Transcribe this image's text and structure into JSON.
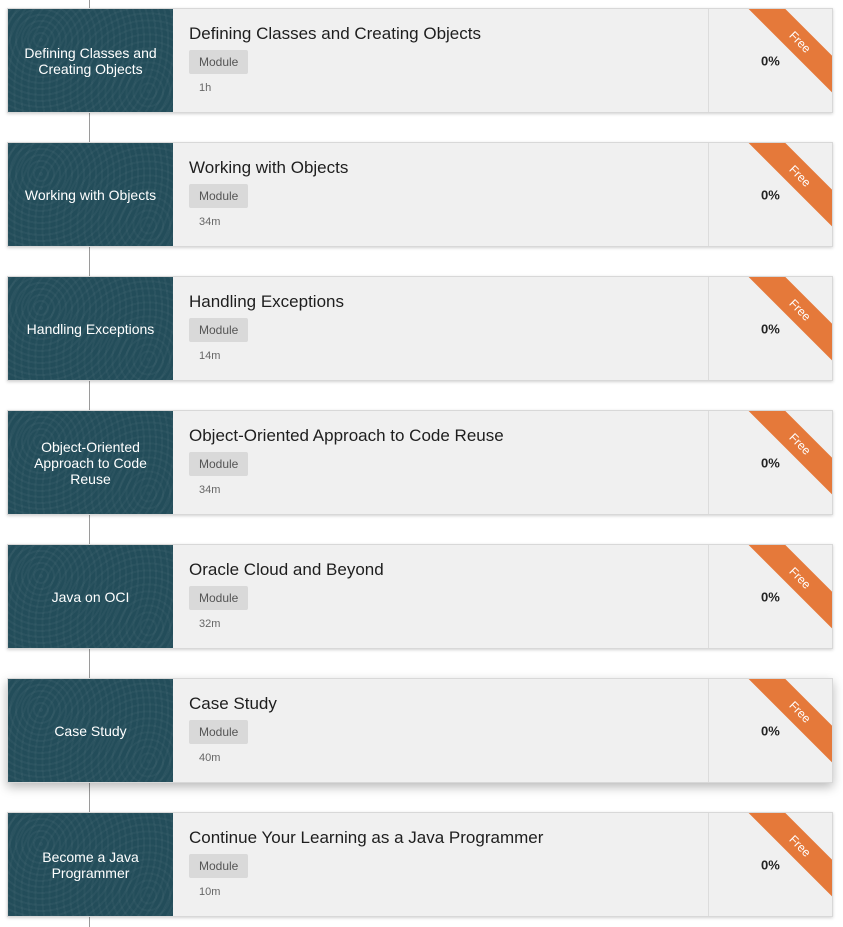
{
  "modules": [
    {
      "thumb": "Defining Classes and Creating Objects",
      "title": "Defining Classes and Creating Objects",
      "badge": "Module",
      "duration": "1h",
      "progress": "0%",
      "ribbon": "Free"
    },
    {
      "thumb": "Working with Objects",
      "title": "Working with Objects",
      "badge": "Module",
      "duration": "34m",
      "progress": "0%",
      "ribbon": "Free"
    },
    {
      "thumb": "Handling Exceptions",
      "title": "Handling Exceptions",
      "badge": "Module",
      "duration": "14m",
      "progress": "0%",
      "ribbon": "Free"
    },
    {
      "thumb": "Object-Oriented Approach to Code Reuse",
      "title": "Object-Oriented Approach to Code Reuse",
      "badge": "Module",
      "duration": "34m",
      "progress": "0%",
      "ribbon": "Free"
    },
    {
      "thumb": "Java on OCI",
      "title": "Oracle Cloud and Beyond",
      "badge": "Module",
      "duration": "32m",
      "progress": "0%",
      "ribbon": "Free"
    },
    {
      "thumb": "Case Study",
      "title": "Case Study",
      "badge": "Module",
      "duration": "40m",
      "progress": "0%",
      "ribbon": "Free"
    },
    {
      "thumb": "Become a Java Programmer",
      "title": "Continue Your Learning as a Java Programmer",
      "badge": "Module",
      "duration": "10m",
      "progress": "0%",
      "ribbon": "Free"
    }
  ],
  "colors": {
    "thumb_bg": "#234d5a",
    "ribbon": "#e5793a",
    "card_bg": "#f0f0f0"
  }
}
